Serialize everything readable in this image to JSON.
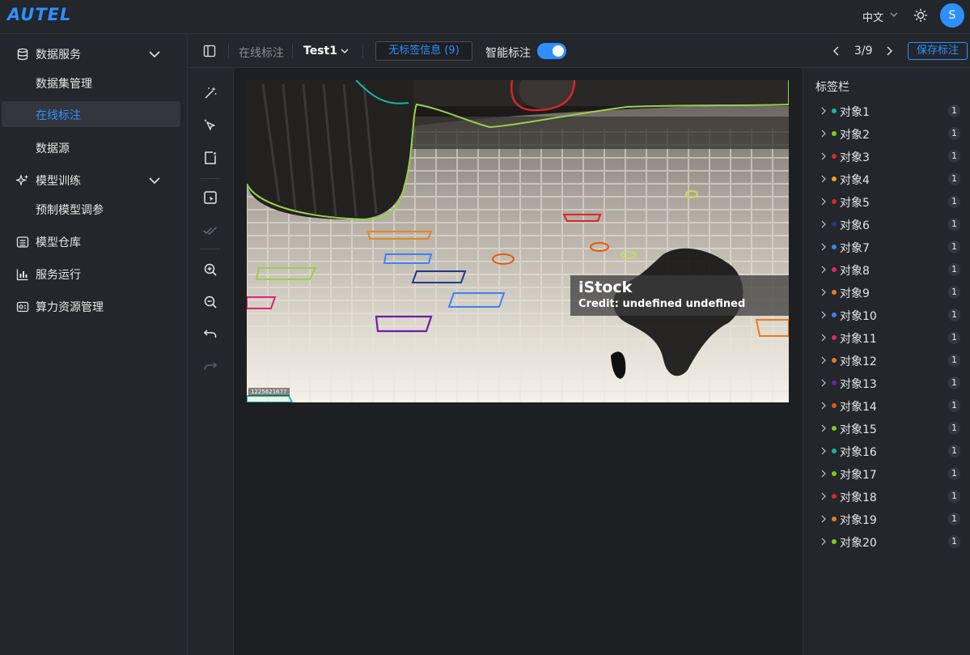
{
  "app": {
    "logo_text": "AUTEL",
    "brand_color": "#2e8fff"
  },
  "header": {
    "language": "中文",
    "avatar_initial": "S",
    "icons": [
      "chevron-down-icon",
      "sun-icon"
    ]
  },
  "sidebar": {
    "groups": [
      {
        "label": "数据服务",
        "icon": "database-icon",
        "expanded": true,
        "children": [
          {
            "label": "数据集管理",
            "active": false
          },
          {
            "label": "在线标注",
            "active": true
          },
          {
            "label": "数据源",
            "active": false
          }
        ]
      },
      {
        "label": "模型训练",
        "icon": "sparkle-icon",
        "expanded": true,
        "children": [
          {
            "label": "预制模型调参",
            "active": false
          }
        ]
      },
      {
        "label": "模型仓库",
        "icon": "warehouse-icon",
        "expanded": false,
        "children": []
      },
      {
        "label": "服务运行",
        "icon": "chart-bars-icon",
        "expanded": false,
        "children": []
      },
      {
        "label": "算力资源管理",
        "icon": "cpu-icon",
        "expanded": false,
        "children": []
      }
    ]
  },
  "toolbar": {
    "breadcrumb_parent": "在线标注",
    "dataset": "Test1",
    "no_label_info": "无标签信息 (9)",
    "smart_label": "智能标注",
    "smart_label_on": true,
    "page_indicator": "3/9",
    "save_label": "保存标注"
  },
  "tools": [
    {
      "name": "magic-wand-icon",
      "enabled": true
    },
    {
      "name": "smart-select-icon",
      "enabled": true
    },
    {
      "name": "polygon-icon",
      "enabled": true
    },
    {
      "name": "annotate-box-icon",
      "enabled": true
    },
    {
      "name": "double-check-icon",
      "enabled": false
    },
    {
      "name": "zoom-in-icon",
      "enabled": true
    },
    {
      "name": "zoom-out-icon",
      "enabled": true
    },
    {
      "name": "undo-icon",
      "enabled": true
    },
    {
      "name": "redo-icon",
      "enabled": false
    }
  ],
  "image": {
    "watermark_title": "iStock",
    "watermark_credit": "Credit: undefined undefined",
    "image_id": "1225621677"
  },
  "label_panel": {
    "title": "标签栏",
    "objects": [
      {
        "name": "对象1",
        "color": "#14b8a6",
        "count": "1"
      },
      {
        "name": "对象2",
        "color": "#84cc16",
        "count": "1"
      },
      {
        "name": "对象3",
        "color": "#dc2626",
        "count": "1"
      },
      {
        "name": "对象4",
        "color": "#f59e0b",
        "count": "1"
      },
      {
        "name": "对象5",
        "color": "#dc2626",
        "count": "1"
      },
      {
        "name": "对象6",
        "color": "#1e3a8a",
        "count": "1"
      },
      {
        "name": "对象7",
        "color": "#3b82f6",
        "count": "1"
      },
      {
        "name": "对象8",
        "color": "#db2777",
        "count": "1"
      },
      {
        "name": "对象9",
        "color": "#ea7c1c",
        "count": "1"
      },
      {
        "name": "对象10",
        "color": "#3b82f6",
        "count": "1"
      },
      {
        "name": "对象11",
        "color": "#db2777",
        "count": "1"
      },
      {
        "name": "对象12",
        "color": "#ea7c1c",
        "count": "1"
      },
      {
        "name": "对象13",
        "color": "#6b21a8",
        "count": "1"
      },
      {
        "name": "对象14",
        "color": "#ea580c",
        "count": "1"
      },
      {
        "name": "对象15",
        "color": "#84cc16",
        "count": "1"
      },
      {
        "name": "对象16",
        "color": "#14b8a6",
        "count": "1"
      },
      {
        "name": "对象17",
        "color": "#84cc16",
        "count": "1"
      },
      {
        "name": "对象18",
        "color": "#dc2626",
        "count": "1"
      },
      {
        "name": "对象19",
        "color": "#ea7c1c",
        "count": "1"
      },
      {
        "name": "对象20",
        "color": "#84cc16",
        "count": "1"
      }
    ]
  }
}
